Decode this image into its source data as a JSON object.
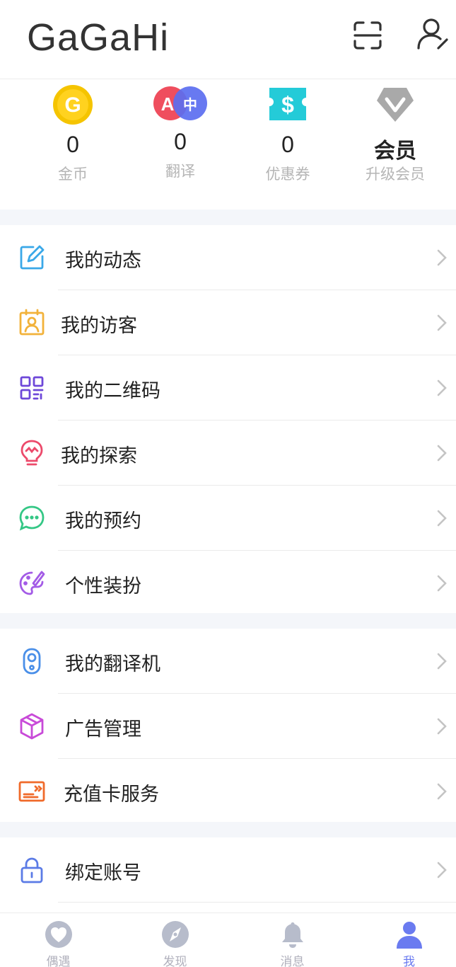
{
  "header": {
    "title": "GaGaHi",
    "scan_icon": "scan-icon",
    "profile_icon": "user-edit-icon"
  },
  "stats": [
    {
      "value": "0",
      "label": "金币",
      "icon": "gold-coin-icon",
      "icon_text": "G"
    },
    {
      "value": "0",
      "label": "翻译",
      "icon": "translate-icon",
      "icon_text_a": "A",
      "icon_text_b": "中"
    },
    {
      "value": "0",
      "label": "优惠券",
      "icon": "coupon-icon",
      "icon_text": "$"
    },
    {
      "value": "会员",
      "label": "升级会员",
      "icon": "vip-diamond-icon"
    }
  ],
  "menu_group_1": [
    {
      "label": "我的动态",
      "icon": "edit-icon",
      "color": "#3aa8e8"
    },
    {
      "label": "我的访客",
      "icon": "visitor-icon",
      "color": "#f2b23a"
    },
    {
      "label": "我的二维码",
      "icon": "qrcode-icon",
      "color": "#6e48d9"
    },
    {
      "label": "我的探索",
      "icon": "bulb-icon",
      "color": "#ec4a6b"
    },
    {
      "label": "我的预约",
      "icon": "chat-bubble-icon",
      "color": "#34c785"
    },
    {
      "label": "个性装扮",
      "icon": "palette-icon",
      "color": "#a35be6"
    }
  ],
  "menu_group_2": [
    {
      "label": "我的翻译机",
      "icon": "translator-device-icon",
      "color": "#4a8fe8"
    },
    {
      "label": "广告管理",
      "icon": "cube-icon",
      "color": "#c84ad8"
    },
    {
      "label": "充值卡服务",
      "icon": "card-icon",
      "color": "#f06a2a"
    }
  ],
  "menu_group_3": [
    {
      "label": "绑定账号",
      "icon": "lock-icon",
      "color": "#5b7be6"
    }
  ],
  "tabbar": [
    {
      "label": "偶遇",
      "icon": "heart-icon",
      "active": false
    },
    {
      "label": "发现",
      "icon": "compass-icon",
      "active": false
    },
    {
      "label": "消息",
      "icon": "bell-icon",
      "active": false
    },
    {
      "label": "我",
      "icon": "person-icon",
      "active": true
    }
  ],
  "colors": {
    "accent": "#6a7bf0",
    "section_gap": "#f4f6fa",
    "label_gray": "#b5b5b5"
  }
}
